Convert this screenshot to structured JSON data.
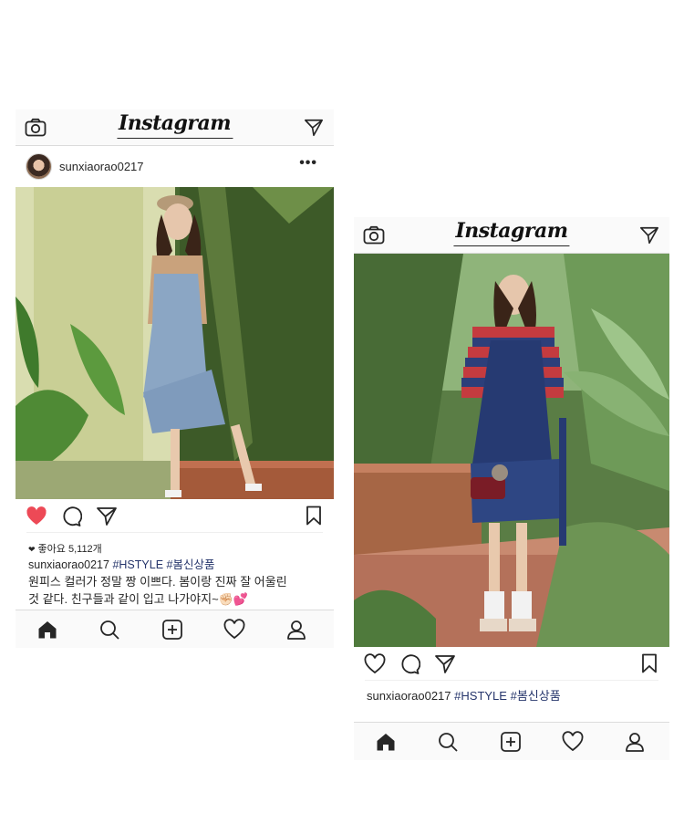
{
  "posts": [
    {
      "header": {
        "logo": "Instagram",
        "camera_icon": "camera-icon",
        "direct_icon": "paper-plane-icon"
      },
      "user": {
        "username": "sunxiaorao0217",
        "more_label": "•••"
      },
      "like_state": "liked",
      "likes_label": "좋아요 5,112개",
      "caption": {
        "username": "sunxiaorao0217",
        "tags": [
          "#HSTYLE",
          "#봄신상품"
        ],
        "text_line1": "원피스 컬러가 정말 짱 이쁘다. 봄이랑 진짜 잘 어울린",
        "text_line2": "것 같다. 친구들과 같이 입고 나가야지~✊🏻💕"
      },
      "tabs": [
        "home-icon",
        "search-icon",
        "add-icon",
        "heart-icon",
        "profile-icon"
      ]
    },
    {
      "header": {
        "logo": "Instagram",
        "camera_icon": "camera-icon",
        "direct_icon": "paper-plane-icon"
      },
      "like_state": "not-liked",
      "caption": {
        "username": "sunxiaorao0217",
        "tags": [
          "#HSTYLE",
          "#봄신상품"
        ]
      },
      "tabs": [
        "home-icon",
        "search-icon",
        "add-icon",
        "heart-icon",
        "profile-icon"
      ]
    }
  ],
  "colors": {
    "like_red": "#ed4956",
    "hashtag": "#25356b",
    "bar_bg": "#fafafa"
  }
}
